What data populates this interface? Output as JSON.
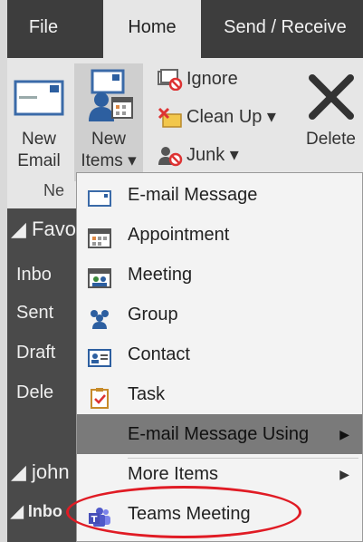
{
  "tabs": {
    "file": "File",
    "home": "Home",
    "send_receive": "Send / Receive"
  },
  "ribbon": {
    "new_email": [
      "New",
      "Email"
    ],
    "new_items": [
      "New",
      "Items ▾"
    ],
    "ignore": "Ignore",
    "clean_up": "Clean Up ▾",
    "junk": "Junk ▾",
    "delete": "Delete",
    "group_label": "Ne"
  },
  "nav": {
    "favorites": "◢ Favo",
    "inbox": "Inbo",
    "sent": "Sent",
    "drafts": "Draft",
    "deleted": "Dele",
    "account": "◢ john",
    "inbox2": "◢ Inbo"
  },
  "menu": {
    "items": [
      {
        "label": "E-mail Message"
      },
      {
        "label": "Appointment"
      },
      {
        "label": "Meeting"
      },
      {
        "label": "Group"
      },
      {
        "label": "Contact"
      },
      {
        "label": "Task"
      },
      {
        "label": "E-mail Message Using",
        "arrow": "▶"
      },
      {
        "label": "More Items",
        "arrow": "▶"
      },
      {
        "label": "Teams Meeting"
      }
    ]
  },
  "colors": {
    "annotation_circle": "#e01b24",
    "teams_purple": "#5059c9"
  }
}
